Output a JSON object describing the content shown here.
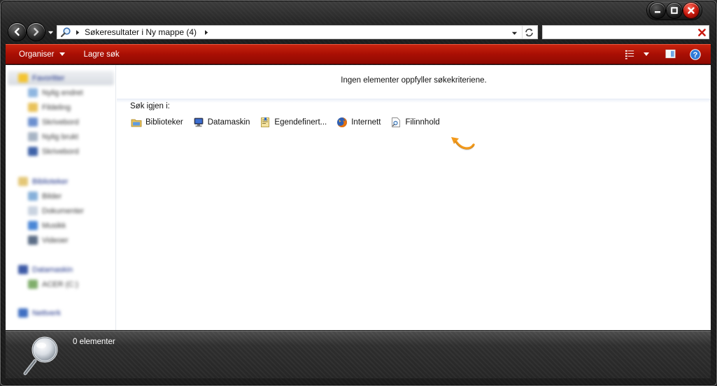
{
  "window": {
    "caption_buttons": [
      "minimize",
      "maximize",
      "close"
    ]
  },
  "address": {
    "path_text": "Søkeresultater i Ny mappe (4)",
    "icon": "search-folder-icon"
  },
  "search": {
    "value": "",
    "clear_icon": "clear-x-icon"
  },
  "toolbar": {
    "organise_label": "Organiser",
    "save_search_label": "Lagre søk",
    "accent": "#b3150a",
    "right_icons": [
      "view-options-icon",
      "view-dropdown-icon",
      "preview-pane-icon",
      "help-icon"
    ]
  },
  "nav_pane": {
    "favorites_header": "Favoritter",
    "favorites": [
      "Nylig endret",
      "Fildeling",
      "Skrivebord",
      "Nylig brukt",
      "Skrivebord"
    ],
    "libraries_header": "Biblioteker",
    "libraries": [
      "Bilder",
      "Dokumenter",
      "Musikk",
      "Videoer"
    ],
    "computer_header": "Datamaskin",
    "computer": [
      "ACER (C:)"
    ],
    "network_header": "Nettverk"
  },
  "results": {
    "no_results_text": "Ingen elementer oppfyller søkekriteriene.",
    "search_again_label": "Søk igjen i:",
    "search_again_links": [
      {
        "label": "Biblioteker",
        "icon": "libraries-icon"
      },
      {
        "label": "Datamaskin",
        "icon": "computer-icon"
      },
      {
        "label": "Egendefinert...",
        "icon": "custom-folder-icon"
      },
      {
        "label": "Internett",
        "icon": "firefox-icon"
      },
      {
        "label": "Filinnhold",
        "icon": "file-contents-icon"
      }
    ],
    "annotation_color": "#f39a1c"
  },
  "details": {
    "item_count": "0 elementer"
  }
}
